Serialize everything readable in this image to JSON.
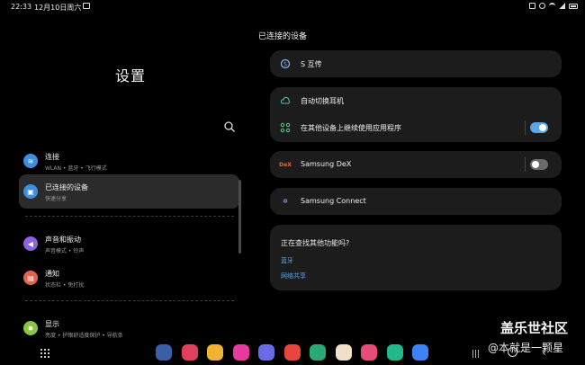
{
  "status_bar": {
    "time": "22:33",
    "date": "12月10日周六"
  },
  "left_panel": {
    "title": "设置",
    "menu": [
      {
        "title": "连接",
        "subtitle": "WLAN • 蓝牙 • 飞行模式",
        "icon": "wifi-icon",
        "color": "#3f8fe0",
        "glyph": "≋"
      },
      {
        "title": "已连接的设备",
        "subtitle": "快速分享",
        "icon": "connected-devices-icon",
        "color": "#3f8fe0",
        "glyph": "▣",
        "selected": true
      },
      {
        "title": "声音和振动",
        "subtitle": "声音模式 • 铃声",
        "icon": "volume-icon",
        "color": "#8e63e0",
        "glyph": "◀"
      },
      {
        "title": "通知",
        "subtitle": "状态栏 • 免打扰",
        "icon": "notification-icon",
        "color": "#e0654f",
        "glyph": "▤"
      },
      {
        "title": "显示",
        "subtitle": "亮度 • 护眼舒适度保护 • 导航条",
        "icon": "display-icon",
        "color": "#8cc63f",
        "glyph": "✹"
      }
    ]
  },
  "right_panel": {
    "title": "已连接的设备",
    "s_transfer": "S 互传",
    "auto_switch": "自动切换耳机",
    "continue_apps": "在其他设备上继续使用应用程序",
    "continue_apps_on": true,
    "dex_icon_text": "DeX",
    "samsung_dex": "Samsung DeX",
    "samsung_dex_on": false,
    "samsung_connect": "Samsung Connect",
    "suggest": {
      "title": "正在查找其他功能吗?",
      "links": [
        "蓝牙",
        "网络共享"
      ]
    }
  },
  "dock": {
    "apps": [
      {
        "name": "settings-app-icon",
        "color": "#3a5fa8"
      },
      {
        "name": "galaxy-store-app-icon",
        "color": "#e0405e"
      },
      {
        "name": "my-files-app-icon",
        "color": "#f2b233"
      },
      {
        "name": "flower-app-icon",
        "color": "#e63aa0"
      },
      {
        "name": "messages-app-icon",
        "color": "#6b6be8"
      },
      {
        "name": "flipboard-app-icon",
        "color": "#e8453c"
      },
      {
        "name": "pen-app-icon",
        "color": "#2aa876"
      },
      {
        "name": "avatar-app-icon",
        "color": "#f0e0c8"
      },
      {
        "name": "music-app-icon",
        "color": "#e84a7a"
      },
      {
        "name": "link-app-icon",
        "color": "#22b888"
      },
      {
        "name": "m-app-icon",
        "color": "#3b82f6"
      }
    ]
  },
  "watermark": {
    "line1": "盖乐世社区",
    "line2": "@本就是一颗星"
  }
}
